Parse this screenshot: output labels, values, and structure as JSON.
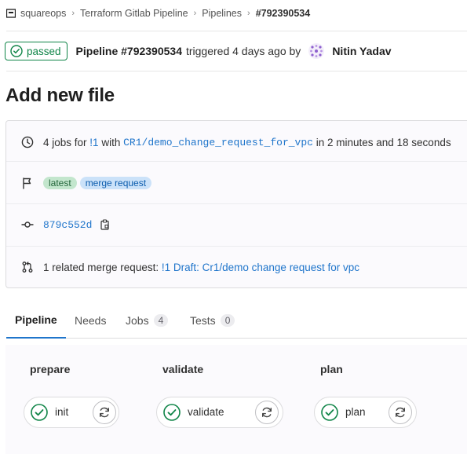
{
  "breadcrumb": {
    "items": [
      "squareops",
      "Terraform Gitlab Pipeline",
      "Pipelines",
      "#792390534"
    ]
  },
  "header": {
    "status": "passed",
    "pipeline_label": "Pipeline #792390534",
    "triggered_text": "triggered 4 days ago by",
    "author": "Nitin Yadav"
  },
  "page_title": "Add new file",
  "info": {
    "jobs_prefix": "4 jobs for",
    "mr_ref": "!1",
    "with_text": "with",
    "branch": "CR1/demo_change_request_for_vpc",
    "duration": "in 2 minutes and 18 seconds",
    "tags": [
      "latest",
      "merge request"
    ],
    "commit_sha": "879c552d",
    "related_prefix": "1 related merge request:",
    "related_link": "!1 Draft: Cr1/demo change request for vpc"
  },
  "tabs": [
    {
      "label": "Pipeline",
      "active": true
    },
    {
      "label": "Needs"
    },
    {
      "label": "Jobs",
      "count": "4"
    },
    {
      "label": "Tests",
      "count": "0"
    }
  ],
  "stages": [
    {
      "title": "prepare",
      "job": "init"
    },
    {
      "title": "validate",
      "job": "validate"
    },
    {
      "title": "plan",
      "job": "plan"
    }
  ],
  "colors": {
    "success": "#108548",
    "link": "#1f75cb",
    "tag_green_bg": "#c3e6cd",
    "tag_blue_bg": "#cbe2f9"
  },
  "icons": [
    "project-icon",
    "check-circle-icon",
    "clock-icon",
    "flag-icon",
    "commit-icon",
    "copy-icon",
    "merge-request-icon",
    "retry-icon"
  ]
}
